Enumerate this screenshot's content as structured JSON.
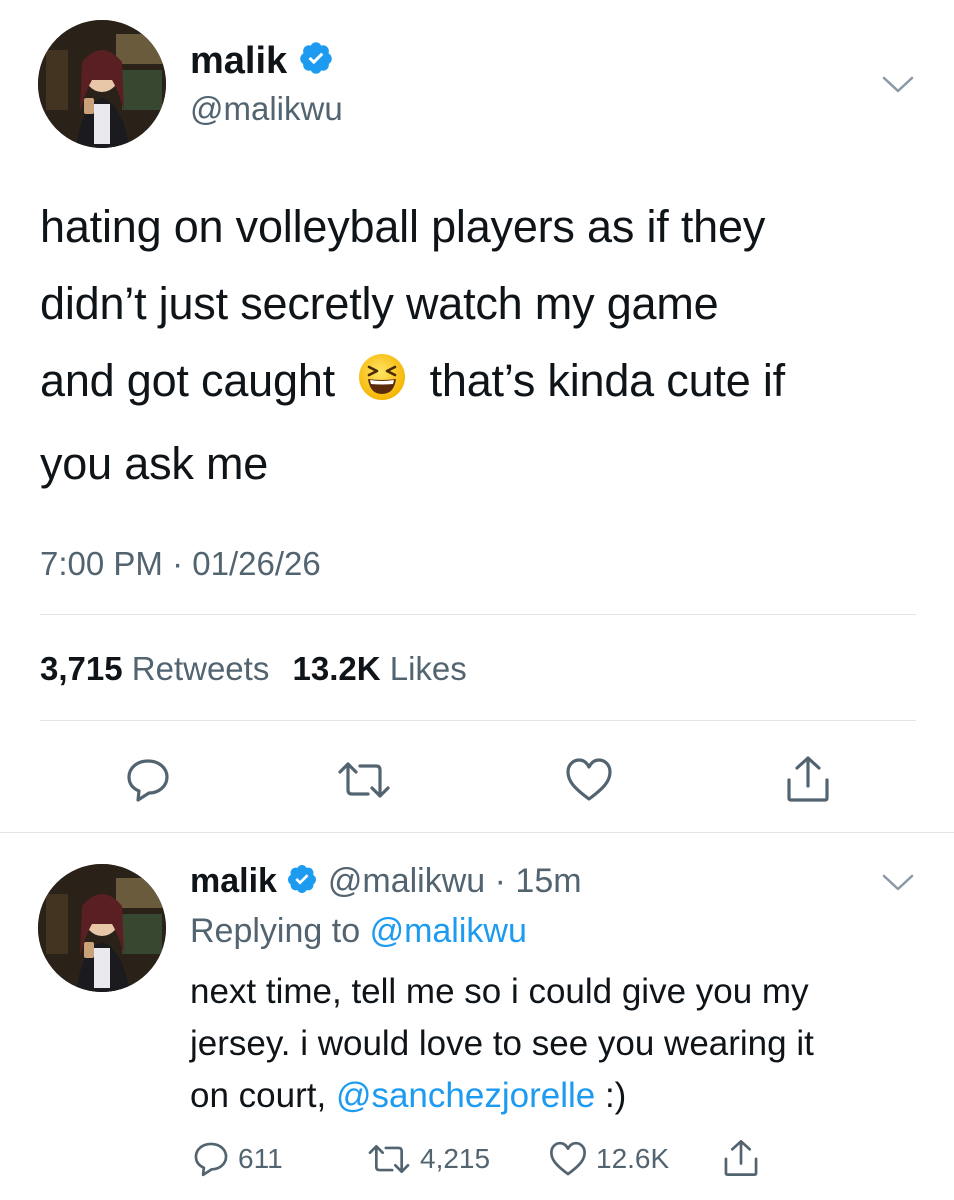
{
  "main_tweet": {
    "display_name": "malik",
    "handle": "@malikwu",
    "text_line1": "hating on volleyball players as if they",
    "text_line2": "didn’t just secretly watch my game",
    "text_line3a": "and got caught",
    "text_line3b": "that’s kinda cute if",
    "text_line4": "you ask me",
    "emoji": "😆",
    "time": "7:00 PM",
    "dot": "·",
    "date": "01/26/26",
    "retweets_count": "3,715",
    "retweets_label": "Retweets",
    "likes_count": "13.2K",
    "likes_label": "Likes"
  },
  "reply_tweet": {
    "display_name": "malik",
    "handle": "@malikwu",
    "dot": "·",
    "age": "15m",
    "replying_to_label": "Replying to",
    "replying_to_handle": "@malikwu",
    "text_line1": "next time, tell me so i could give you my",
    "text_line2": "jersey. i would love to see you wearing it",
    "text_line3a": "on court,",
    "mention": "@sanchezjorelle",
    "text_line3b": ":)",
    "reply_count": "611",
    "retweet_count": "4,215",
    "like_count": "12.6K"
  },
  "icons": {
    "verified": "verified-badge-icon",
    "chevron": "chevron-down-icon",
    "reply": "comment-bubble-icon",
    "retweet": "retweet-icon",
    "like": "heart-icon",
    "share": "share-icon"
  },
  "colors": {
    "accent": "#1d9bf0",
    "text": "#0f1419",
    "secondary": "#536471",
    "divider": "#e1e4e8"
  }
}
